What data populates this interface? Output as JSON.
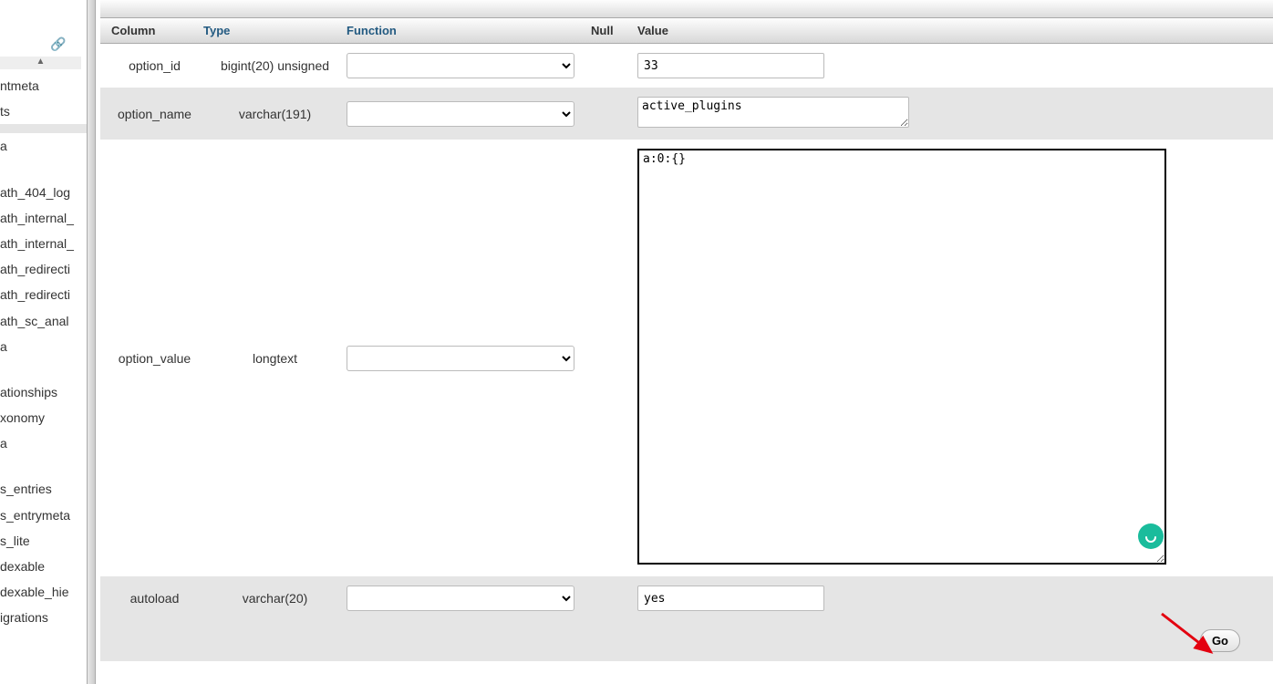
{
  "sidebar": {
    "items": [
      {
        "label": "ntmeta"
      },
      {
        "label": "ts"
      },
      {
        "label": "",
        "highlight": true
      },
      {
        "label": "a"
      },
      {
        "label": "",
        "gap": true
      },
      {
        "label": "ath_404_log"
      },
      {
        "label": "ath_internal_"
      },
      {
        "label": "ath_internal_"
      },
      {
        "label": "ath_redirecti"
      },
      {
        "label": "ath_redirecti"
      },
      {
        "label": "ath_sc_anal"
      },
      {
        "label": "a"
      },
      {
        "label": "",
        "gap": true
      },
      {
        "label": "ationships"
      },
      {
        "label": "xonomy"
      },
      {
        "label": "a"
      },
      {
        "label": "",
        "gap": true
      },
      {
        "label": "s_entries"
      },
      {
        "label": "s_entrymeta"
      },
      {
        "label": "s_lite"
      },
      {
        "label": "dexable"
      },
      {
        "label": "dexable_hie"
      },
      {
        "label": "igrations"
      }
    ]
  },
  "headers": {
    "column": "Column",
    "type": "Type",
    "function": "Function",
    "null": "Null",
    "value": "Value"
  },
  "rows": [
    {
      "column": "option_id",
      "type": "bigint(20) unsigned",
      "value": "33",
      "input": "text"
    },
    {
      "column": "option_name",
      "type": "varchar(191)",
      "value": "active_plugins",
      "input": "textarea-small",
      "alt": true
    },
    {
      "column": "option_value",
      "type": "longtext",
      "value": "a:0:{}",
      "input": "textarea-big"
    },
    {
      "column": "autoload",
      "type": "varchar(20)",
      "value": "yes",
      "input": "text",
      "alt": true
    }
  ],
  "footer": {
    "go": "Go"
  }
}
